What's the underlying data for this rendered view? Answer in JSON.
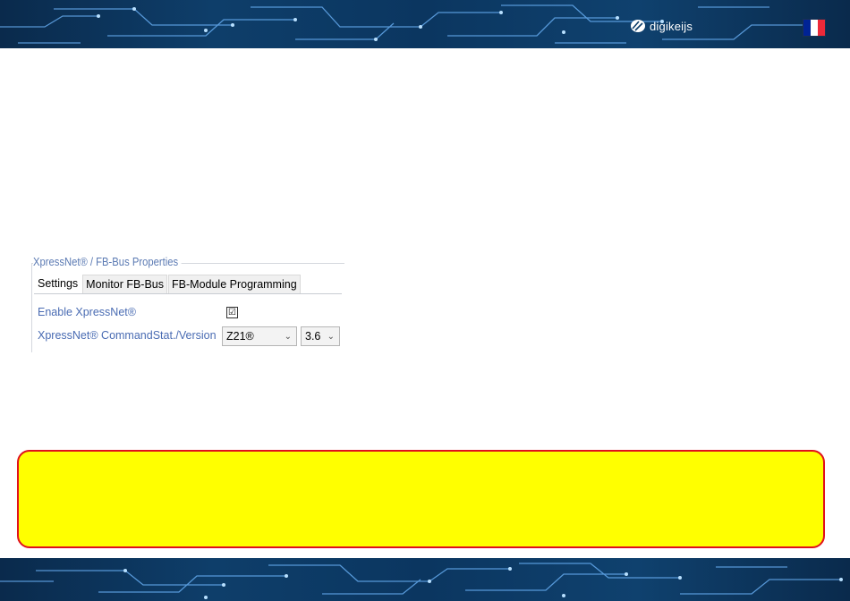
{
  "header": {
    "brand_name": "digikeijs",
    "language_flag_colors": [
      "#002395",
      "#ffffff",
      "#ed2939"
    ],
    "banner_color": "#0e3e6a"
  },
  "panel": {
    "group_title": "XpressNet® / FB-Bus Properties",
    "tabs": [
      {
        "label": "Settings",
        "active": true
      },
      {
        "label": "Monitor FB-Bus",
        "active": false
      },
      {
        "label": "FB-Module Programming",
        "active": false
      }
    ],
    "enable_label": "Enable XpressNet®",
    "enable_checked": true,
    "enable_check_glyph": "☑",
    "commandstation_label": "XpressNet® CommandStat./Version",
    "commandstation_value": "Z21®",
    "version_value": "3.6",
    "label_color": "#4a6cb3"
  },
  "callout": {
    "fill_color": "#ffff00",
    "border_color": "#e0101c"
  }
}
